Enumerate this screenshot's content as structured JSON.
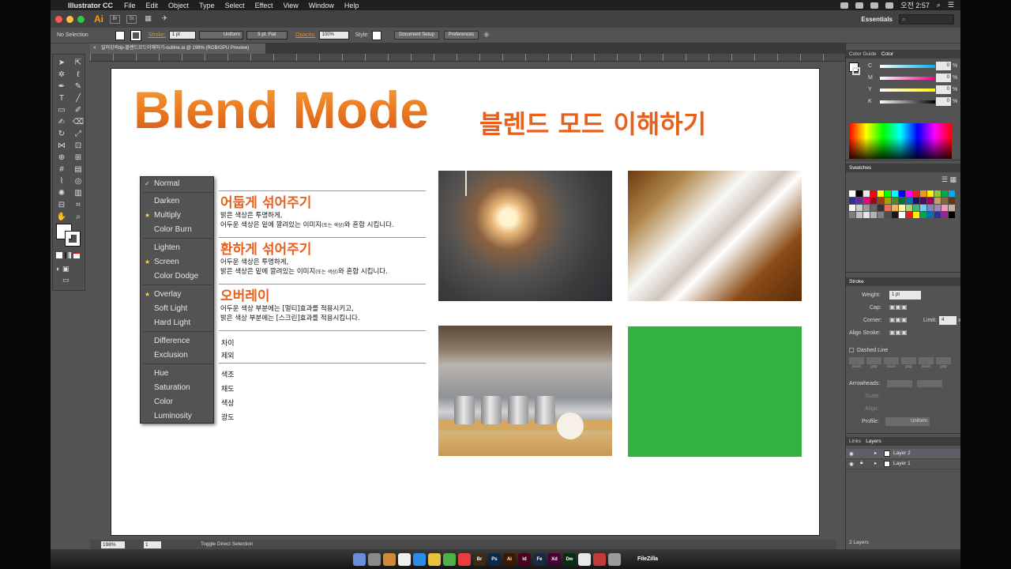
{
  "menubar": {
    "app_name": "Illustrator CC",
    "items": [
      "File",
      "Edit",
      "Object",
      "Type",
      "Select",
      "Effect",
      "View",
      "Window",
      "Help"
    ],
    "clock": "오전 2:57"
  },
  "appbar": {
    "logo": "Ai",
    "bridge": "Br",
    "stock": "St",
    "workspace": "Essentials"
  },
  "controlbar": {
    "selection": "No Selection",
    "stroke_label": "Stroke:",
    "stroke_weight": "1 pt",
    "profile": "Uniform",
    "brush": "5 pt. Flat",
    "opacity_label": "Opacity:",
    "opacity": "100%",
    "style_label": "Style:",
    "document_setup": "Document Setup",
    "preferences": "Preferences"
  },
  "document": {
    "tab_title": "일러강의tip-블렌드모드이해하기-outline.ai @ 198% (RGB/GPU Preview)"
  },
  "artboard": {
    "title_en": "Blend Mode",
    "title_kr": "블렌드 모드 이해하기"
  },
  "blend_menu": {
    "items": [
      {
        "label": "Normal",
        "mark": "✓"
      },
      {
        "label": "Darken",
        "mark": ""
      },
      {
        "label": "Multiply",
        "mark": "★"
      },
      {
        "label": "Color Burn",
        "mark": ""
      },
      {
        "label": "Lighten",
        "mark": ""
      },
      {
        "label": "Screen",
        "mark": "★"
      },
      {
        "label": "Color Dodge",
        "mark": ""
      },
      {
        "label": "Overlay",
        "mark": "★"
      },
      {
        "label": "Soft Light",
        "mark": ""
      },
      {
        "label": "Hard Light",
        "mark": ""
      },
      {
        "label": "Difference",
        "mark": ""
      },
      {
        "label": "Exclusion",
        "mark": ""
      },
      {
        "label": "Hue",
        "mark": ""
      },
      {
        "label": "Saturation",
        "mark": ""
      },
      {
        "label": "Color",
        "mark": ""
      },
      {
        "label": "Luminosity",
        "mark": ""
      }
    ]
  },
  "descriptions": {
    "darken": {
      "title": "어둡게 섞어주기",
      "line1": "밝은 색상은 투명하게,",
      "line2a": "어두운 색상은 밑에 깔려있는 이미지",
      "line2b": "(또는 색상)",
      "line2c": "와 혼합 시킵니다."
    },
    "lighten": {
      "title": "환하게 섞어주기",
      "line1": "어두운 색상은 투명하게,",
      "line2a": "밝은 색상은 밑에 깔려있는 이미지",
      "line2b": "(또는 색상)",
      "line2c": "와 혼합 시킵니다."
    },
    "overlay": {
      "title": "오버레이",
      "line1": "어두운 색상 부분에는 [멀티]효과를 적용시키고,",
      "line2": "밝은 색상 부분에는 [스크린]효과를 적용시킵니다."
    },
    "difference": "차이",
    "exclusion": "제외",
    "hue": "색조",
    "saturation": "채도",
    "color": "색상",
    "luminosity": "광도"
  },
  "panels": {
    "color_guide_tab": "Color Guide",
    "color_tab": "Color",
    "cmyk": [
      {
        "ch": "C",
        "value": "0",
        "color": "#00aeef"
      },
      {
        "ch": "M",
        "value": "0",
        "color": "#ec008c"
      },
      {
        "ch": "Y",
        "value": "0",
        "color": "#fff200"
      },
      {
        "ch": "K",
        "value": "0",
        "color": "#000000"
      }
    ],
    "percent": "%",
    "swatches_tab": "Swatches",
    "stroke_tab": "Stroke",
    "weight_label": "Weight:",
    "weight_value": "1 pt",
    "cap_label": "Cap:",
    "corner_label": "Corner:",
    "limit_label": "Limit:",
    "limit_value": "4",
    "limit_unit": "x",
    "align_label": "Align Stroke:",
    "dashed_line": "Dashed Line",
    "dash_labels": [
      "dash",
      "gap",
      "dash",
      "gap",
      "dash",
      "gap"
    ],
    "arrowheads": "Arrowheads:",
    "scale": "Scale:",
    "align": "Align:",
    "profile_label": "Profile:",
    "profile_value": "Uniform",
    "links_tab": "Links",
    "layers_tab": "Layers",
    "layers": [
      {
        "name": "Layer 2",
        "selected": true
      },
      {
        "name": "Layer 1",
        "selected": false
      }
    ],
    "layer_count": "2 Layers"
  },
  "status": {
    "zoom": "198%",
    "page": "1",
    "tool": "Toggle Direct Selection"
  },
  "dock": {
    "apps": [
      {
        "label": "Br",
        "color": "#3d2a10"
      },
      {
        "label": "Ps",
        "color": "#0b2a47"
      },
      {
        "label": "Ai",
        "color": "#3b1a00"
      },
      {
        "label": "Id",
        "color": "#49021f"
      },
      {
        "label": "Fe",
        "color": "#1b2a44"
      },
      {
        "label": "Xd",
        "color": "#470137"
      },
      {
        "label": "Dw",
        "color": "#072c10"
      }
    ],
    "filezilla": "FileZilla"
  }
}
